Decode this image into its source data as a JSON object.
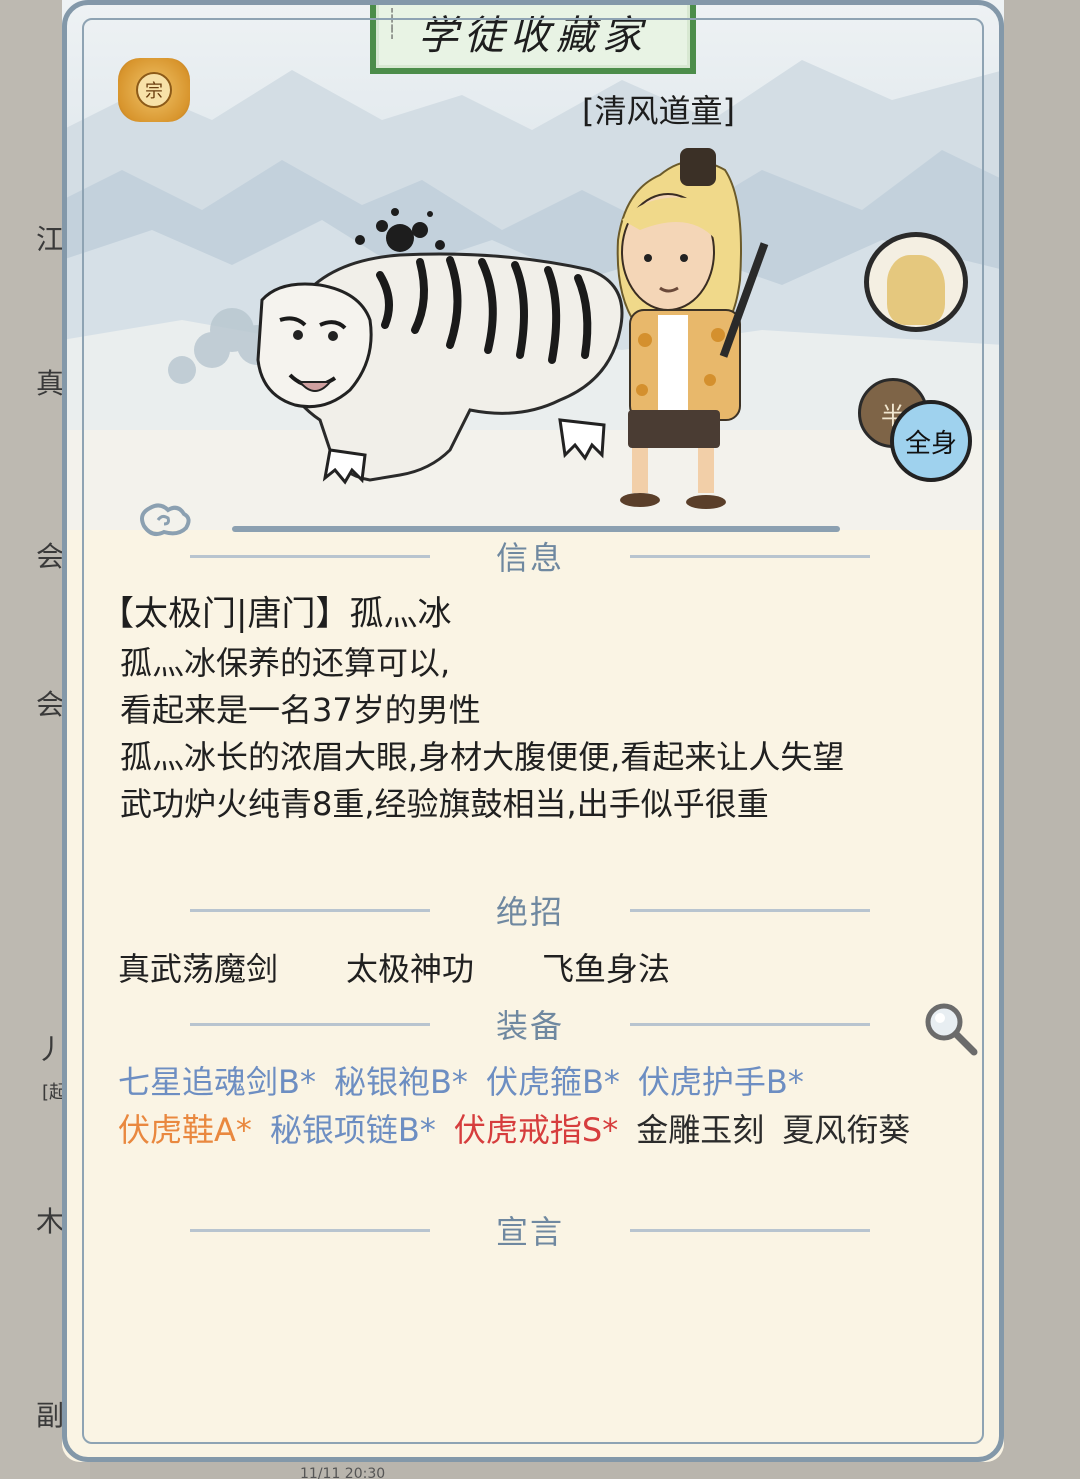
{
  "background_page": {
    "left_chars": [
      "江",
      "真",
      "会",
      "会",
      "丿",
      "[起",
      "木",
      "副"
    ],
    "bottom_text": "11/11 20:30"
  },
  "title": "学徒收藏家",
  "sect_badge": "宗",
  "character": {
    "name": "[清风道童]"
  },
  "buttons": {
    "half": "半",
    "full": "全身"
  },
  "sections": {
    "info": "信息",
    "skills": "绝招",
    "equipment": "装备",
    "declaration": "宣言"
  },
  "info": {
    "title": "【太极门|唐门】孤灬冰",
    "lines": [
      "孤灬冰保养的还算可以,",
      "看起来是一名37岁的男性",
      "孤灬冰长的浓眉大眼,身材大腹便便,看起来让人失望",
      "武功炉火纯青8重,经验旗鼓相当,出手似乎很重"
    ]
  },
  "skills": [
    "真武荡魔剑",
    "太极神功",
    "飞鱼身法"
  ],
  "equipment": [
    {
      "name": "七星追魂剑B*",
      "tier": "B"
    },
    {
      "name": "秘银袍B*",
      "tier": "B"
    },
    {
      "name": "伏虎箍B*",
      "tier": "B"
    },
    {
      "name": "伏虎护手B*",
      "tier": "B"
    },
    {
      "name": "伏虎鞋A*",
      "tier": "A"
    },
    {
      "name": "秘银项链B*",
      "tier": "B"
    },
    {
      "name": "伏虎戒指S*",
      "tier": "S"
    },
    {
      "name": "金雕玉刻",
      "tier": "N"
    },
    {
      "name": "夏风衔葵",
      "tier": "N"
    }
  ],
  "colors": {
    "tier_B": "#6d8ec2",
    "tier_A": "#e9883f",
    "tier_S": "#d63d3d",
    "frame": "#8398a9",
    "header": "#6f88a0"
  },
  "icons": {
    "sect": "sect-badge-icon",
    "mount": "horse-icon",
    "search": "magnifier-icon",
    "cloud": "cloud-swirl-icon"
  }
}
